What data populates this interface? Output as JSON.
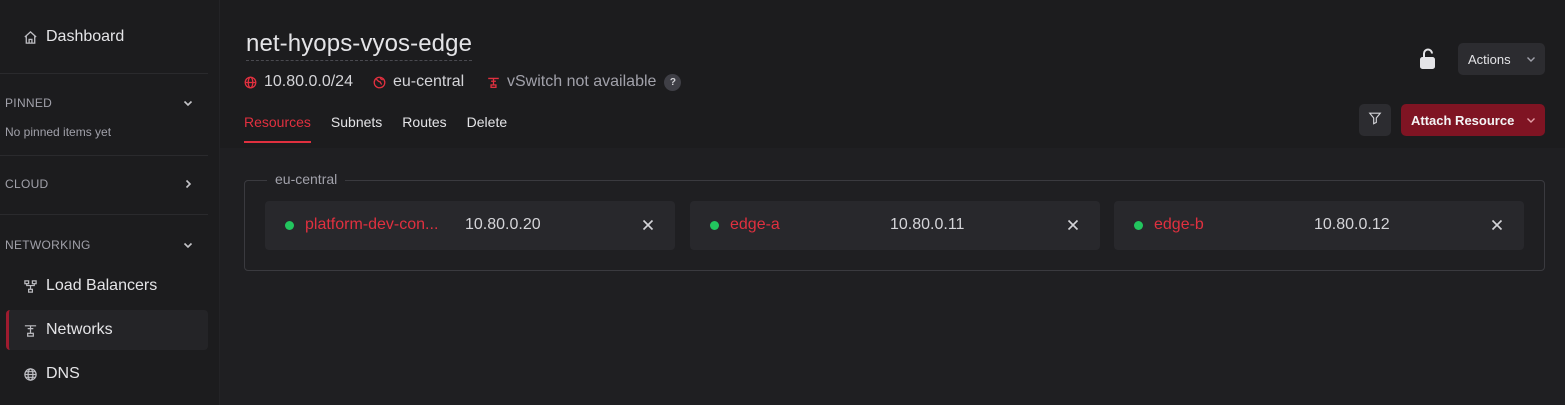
{
  "sidebar": {
    "dashboard": "Dashboard",
    "pinned": {
      "label": "PINNED",
      "empty": "No pinned items yet"
    },
    "cloud": {
      "label": "CLOUD"
    },
    "networking": {
      "label": "NETWORKING",
      "items": [
        {
          "label": "Load Balancers",
          "icon": "load-balancer-icon"
        },
        {
          "label": "Networks",
          "icon": "network-icon",
          "active": true
        },
        {
          "label": "DNS",
          "icon": "globe-icon"
        }
      ]
    }
  },
  "header": {
    "title": "net-hyops-vyos-edge",
    "cidr": "10.80.0.0/24",
    "region": "eu-central",
    "vswitch": "vSwitch not available",
    "help": "?",
    "tabs": [
      {
        "label": "Resources",
        "active": true
      },
      {
        "label": "Subnets"
      },
      {
        "label": "Routes"
      },
      {
        "label": "Delete"
      }
    ],
    "actions_label": "Actions",
    "attach_label": "Attach Resource"
  },
  "main": {
    "group_label": "eu-central",
    "resources": [
      {
        "name": "platform-dev-con...",
        "ip": "10.80.0.20",
        "status": "running"
      },
      {
        "name": "edge-a",
        "ip": "10.80.0.11",
        "status": "running"
      },
      {
        "name": "edge-b",
        "ip": "10.80.0.12",
        "status": "running"
      }
    ]
  },
  "colors": {
    "accent": "#e0303f",
    "primary_button": "#7f1423",
    "status_ok": "#22c55e"
  }
}
